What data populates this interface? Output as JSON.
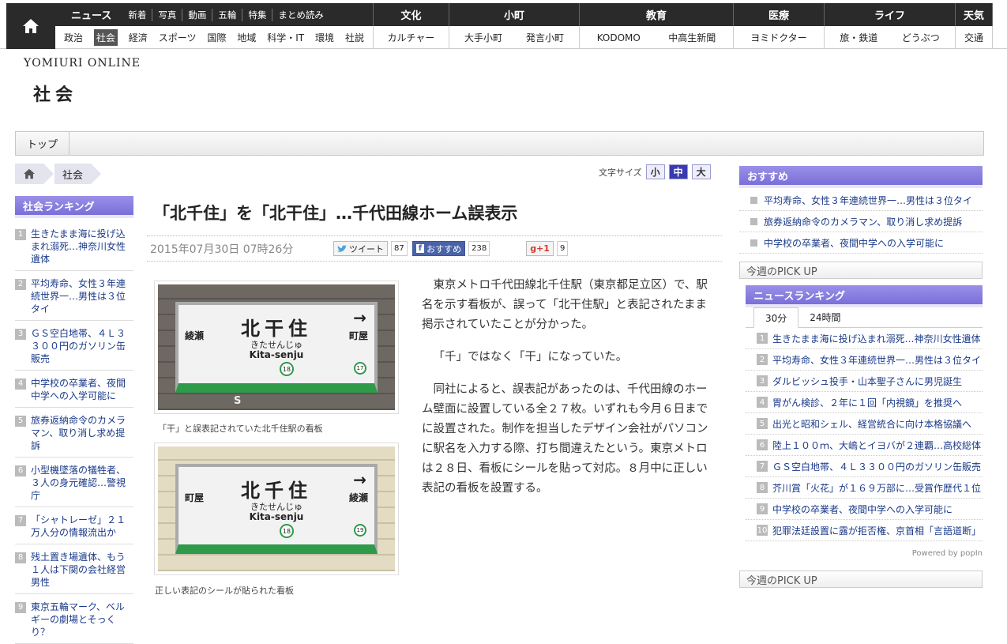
{
  "nav": {
    "news": {
      "label": "ニュース",
      "sub": [
        "新着",
        "写真",
        "動画",
        "五輪",
        "特集",
        "まとめ読み"
      ],
      "items": [
        "政治",
        "社会",
        "経済",
        "スポーツ",
        "国際",
        "地域",
        "科学・IT",
        "環境",
        "社説"
      ],
      "active": "社会"
    },
    "culture": {
      "label": "文化",
      "items": [
        "カルチャー"
      ]
    },
    "komachi": {
      "label": "小町",
      "items": [
        "大手小町",
        "発言小町"
      ]
    },
    "education": {
      "label": "教育",
      "items": [
        "KODOMO",
        "中高生新聞"
      ]
    },
    "medical": {
      "label": "医療",
      "items": [
        "ヨミドクター"
      ]
    },
    "life": {
      "label": "ライフ",
      "items": [
        "旅・鉄道",
        "どうぶつ"
      ]
    },
    "weather": {
      "label": "天気",
      "items": [
        "交通"
      ]
    }
  },
  "brand": "YOMIURI ONLINE",
  "section_title": "社会",
  "breadbar_tab": "トップ",
  "breadcrumb": [
    "社会"
  ],
  "font_size": {
    "label": "文字サイズ",
    "small": "小",
    "medium": "中",
    "large": "大"
  },
  "left_ranking": {
    "title": "社会ランキング",
    "items": [
      "生きたまま海に投げ込まれ溺死…神奈川女性遺体",
      "平均寿命、女性３年連続世界一…男性は３位タイ",
      "ＧＳ空白地帯、４Ｌ３３００円のガソリン缶販売",
      "中学校の卒業者、夜間中学への入学可能に",
      "旅券返納命令のカメラマン、取り消し求め提訴",
      "小型機墜落の犠牲者、３人の身元確認…警視庁",
      "「シャトレーゼ」２１万人分の情報流出か",
      "残土置き場遺体、もう１人は下関の会社経営男性",
      "東京五輪マーク、ベルギーの劇場とそっくり？"
    ]
  },
  "article": {
    "headline": "「北千住」を「北干住」…千代田線ホーム誤表示",
    "date": "2015年07月30日 07時26分",
    "tweet": "ツイート",
    "tweet_count": "87",
    "fb": "おすすめ",
    "fb_count": "238",
    "gplus": "g+1",
    "gplus_count": "9",
    "caption1": "「干」と誤表記されていた北千住駅の看板",
    "caption2": "正しい表記のシールが貼られた看板",
    "paragraphs": [
      "東京メトロ千代田線北千住駅（東京都足立区）で、駅名を示す看板が、誤って「北干住駅」と表記されたまま掲示されていたことが分かった。",
      "「千」ではなく「干」になっていた。",
      "同社によると、誤表記があったのは、千代田線のホーム壁面に設置している全２７枚。いずれも今月６日までに設置された。制作を担当したデザイン会社がパソコンに駅名を入力する際、打ち間違えたという。東京メトロは２８日、看板にシールを貼って対応。８月中に正しい表記の看板を設置する。"
    ]
  },
  "sign1": {
    "main": "北干住",
    "kana": "きたせんじゅ",
    "rom": "Kita-senju",
    "left": "綾瀬",
    "left_kana": "あやせ",
    "left_rom": "Ayase",
    "right": "町屋",
    "right_kana": "まちや",
    "right_rom": "Machiya",
    "num": "18",
    "num2": "17",
    "arrow": "→",
    "s_mark": "S"
  },
  "sign2": {
    "main": "北千住",
    "kana": "きたせんじゅ",
    "rom": "Kita-senju",
    "left": "町屋",
    "left_kana": "まちや",
    "left_rom": "Machiya",
    "right": "綾瀬",
    "right_kana": "あやせ",
    "right_rom": "Ayase",
    "num": "18",
    "num2": "19",
    "arrow": "→"
  },
  "recommend": {
    "title": "おすすめ",
    "items": [
      "平均寿命、女性３年連続世界一…男性は３位タイ",
      "旅券返納命令のカメラマン、取り消し求め提訴",
      "中学校の卒業者、夜間中学への入学可能に"
    ]
  },
  "pickup_label": "今週のPICK UP",
  "news_ranking": {
    "title": "ニュースランキング",
    "tabs": [
      "30分",
      "24時間"
    ],
    "items": [
      "生きたまま海に投げ込まれ溺死…神奈川女性遺体",
      "平均寿命、女性３年連続世界一…男性は３位タイ",
      "ダルビッシュ投手・山本聖子さんに男児誕生",
      "胃がん検診、２年に１回「内視鏡」を推奨へ",
      "出光と昭和シェル、経営統合に向け本格協議へ",
      "陸上１００ｍ、大嶋とイヨバが２連覇…高校総体",
      "ＧＳ空白地帯、４Ｌ３３００円のガソリン缶販売",
      "芥川賞「火花」が１６９万部に…受賞作歴代１位",
      "中学校の卒業者、夜間中学への入学可能に",
      "犯罪法廷設置に露が拒否権、京首相「言語道断」"
    ],
    "powered": "Powered by popIn"
  },
  "pickup_label2": "今週のPICK UP"
}
